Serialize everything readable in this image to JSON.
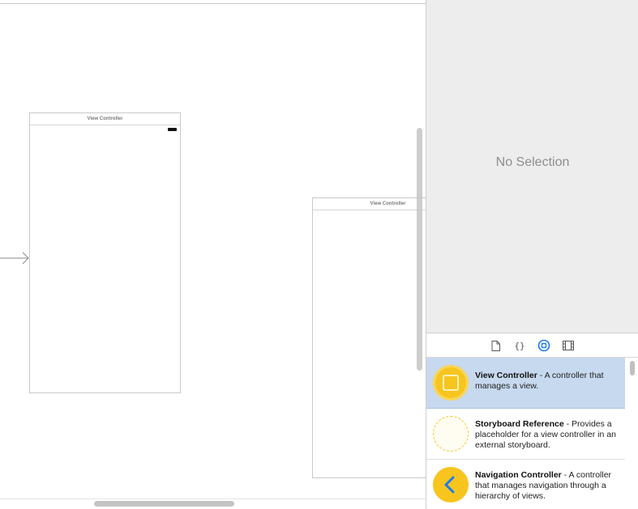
{
  "canvas": {
    "scenes": [
      {
        "title": "View Controller"
      },
      {
        "title": "View Controller"
      }
    ]
  },
  "inspector": {
    "empty_text": "No Selection"
  },
  "library": {
    "tabs": [
      "file-template-icon",
      "code-snippet-icon",
      "object-library-icon",
      "media-library-icon"
    ],
    "items": [
      {
        "name": "View Controller",
        "desc": " - A controller that manages a view.",
        "selected": true
      },
      {
        "name": "Storyboard Reference",
        "desc": " - Provides a placeholder for a view controller in an external storyboard.",
        "selected": false
      },
      {
        "name": "Navigation Controller",
        "desc": " - A controller that manages navigation through a hierarchy of views.",
        "selected": false
      }
    ]
  },
  "colors": {
    "accent": "#1f7af0",
    "selection": "#c7d9ef",
    "thumb_yellow": "#f7c51e"
  }
}
